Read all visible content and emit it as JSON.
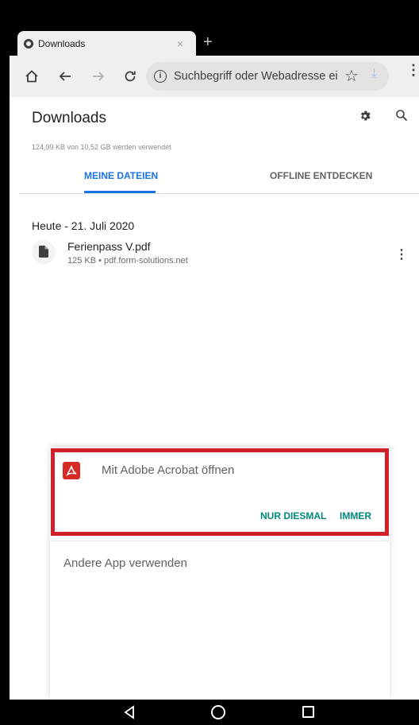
{
  "browser": {
    "tab_title": "Downloads",
    "tab_close": "×",
    "new_tab": "+",
    "omnibox_placeholder": "Suchbegriff oder Webadresse ei",
    "info_glyph": "i"
  },
  "downloads": {
    "title": "Downloads",
    "storage_text": "124,99 KB von 10,52 GB werden verwendet",
    "tabs": [
      {
        "label": "MEINE DATEIEN",
        "active": true
      },
      {
        "label": "OFFLINE ENTDECKEN",
        "active": false
      }
    ],
    "date_header": "Heute - 21. Juli 2020",
    "items": [
      {
        "name": "Ferienpass V.pdf",
        "meta": "125 KB • pdf.form-solutions.net"
      }
    ]
  },
  "dialog": {
    "open_with_label": "Mit Adobe Acrobat öffnen",
    "just_once_label": "NUR DIESMAL",
    "always_label": "IMMER",
    "other_app_label": "Andere App verwenden"
  },
  "colors": {
    "accent_blue": "#1a73e8",
    "dialog_button": "#00897b",
    "highlight_red": "#d0202a",
    "acrobat_red": "#d62b25"
  },
  "icons": {
    "home": "home-icon",
    "back": "back-arrow-icon",
    "forward": "forward-arrow-icon",
    "reload": "reload-icon",
    "info": "info-icon",
    "bookmark": "star-icon",
    "download": "download-icon",
    "menu": "more-vert-icon",
    "settings": "gear-icon",
    "search": "search-icon",
    "file": "file-icon",
    "acrobat": "adobe-acrobat-icon",
    "nav_back": "nav-back-icon",
    "nav_home": "nav-home-icon",
    "nav_recents": "nav-recents-icon"
  }
}
